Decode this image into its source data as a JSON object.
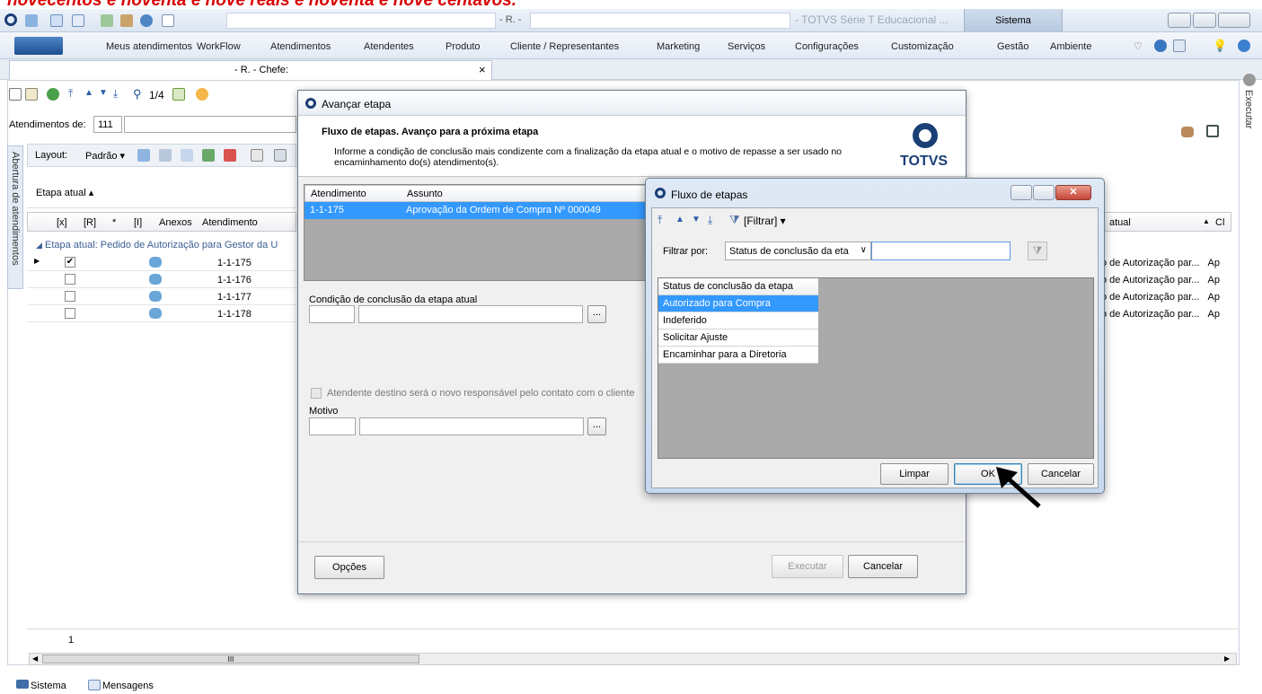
{
  "banner_text": "novecentos e noventa e nove reais e noventa e nove centavos.",
  "window": {
    "title_mid": "- R. -",
    "title_right": "- TOTVS Série T Educacional ...",
    "sistema_tab": "Sistema"
  },
  "menu": {
    "items": [
      "Meus atendimentos",
      "WorkFlow",
      "Atendimentos",
      "Atendentes",
      "Produto",
      "Cliente / Representantes",
      "Marketing",
      "Serviços",
      "Configurações",
      "Customização",
      "Gestão",
      "Ambiente"
    ]
  },
  "doc_tab": {
    "label": "- R. - Chefe:",
    "close": "×"
  },
  "toolbar": {
    "page_indicator": "1/4"
  },
  "filter": {
    "label": "Atendimentos de:",
    "value": "111"
  },
  "layout_bar": {
    "label": "Layout:",
    "preset": "Padrão"
  },
  "side_panel": {
    "left_label": "Abertura de atendimentos",
    "right_label": "Executar"
  },
  "group": {
    "label": "Etapa atual"
  },
  "grid": {
    "headers": [
      "[x]",
      "[R]",
      "*",
      "[I]",
      "Anexos",
      "Atendimento"
    ],
    "group_row": "Etapa atual: Pedido de Autorização para Gestor da U",
    "rows": [
      {
        "id": "1-1-175",
        "checked": true
      },
      {
        "id": "1-1-176",
        "checked": false
      },
      {
        "id": "1-1-177",
        "checked": false
      },
      {
        "id": "1-1-178",
        "checked": false
      }
    ],
    "right_header": "atual",
    "right_header2": "Cl",
    "right_rows": [
      "o de Autorização par...",
      "o de Autorização par...",
      "o de Autorização par...",
      "o de Autorização par..."
    ],
    "right_suffix": "Ap",
    "footer_page": "1",
    "scroll_label": "III"
  },
  "avancar": {
    "title": "Avançar etapa",
    "heading": "Fluxo de etapas. Avanço para a próxima etapa",
    "desc": "Informe a condição de conclusão mais condizente com a finalização da etapa atual e o motivo de repasse a ser usado no encaminhamento do(s) atendimento(s).",
    "logo_text": "TOTVS",
    "col_atendimento": "Atendimento",
    "col_assunto": "Assunto",
    "row_id": "1-1-175",
    "row_subject": "Aprovação da Ordem de Compra Nº 000049",
    "cond_label": "Condição de conclusão da etapa atual",
    "checkbox_label": "Atendente destino será o novo responsável pelo contato com o cliente",
    "motivo_label": "Motivo",
    "browse": "...",
    "opcoes": "Opções",
    "executar": "Executar",
    "cancelar": "Cancelar"
  },
  "fluxo": {
    "title": "Fluxo de etapas",
    "filter_menu": "[Filtrar]",
    "filtrar_por": "Filtrar por:",
    "select_value": "Status de conclusão da eta",
    "list_header": "Status de conclusão da etapa",
    "items": [
      "Autorizado para Compra",
      "Indeferido",
      "Solicitar Ajuste",
      "Encaminhar para a Diretoria"
    ],
    "limpar": "Limpar",
    "ok": "OK",
    "cancelar": "Cancelar"
  },
  "statusbar": {
    "sistema": "Sistema",
    "mensagens": "Mensagens"
  },
  "colors": {
    "selection": "#3399ff",
    "totvs_blue": "#1a3f77",
    "banner_red": "#d80000"
  }
}
